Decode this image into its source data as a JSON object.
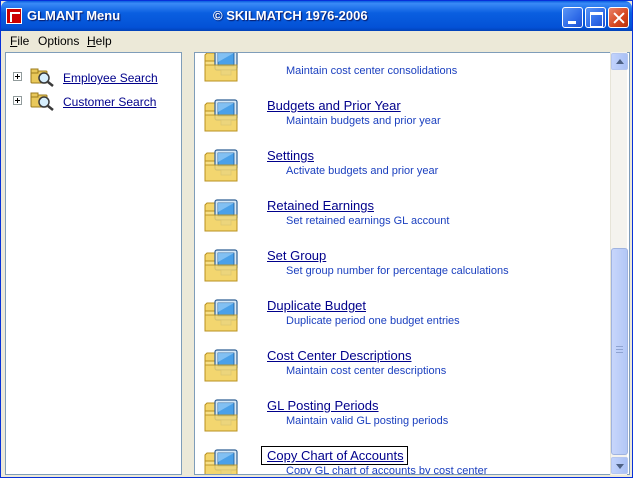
{
  "window": {
    "title": "GLMANT Menu",
    "copyright": "© SKILMATCH 1976-2006"
  },
  "menu": [
    {
      "label_rest": "ile",
      "label_mnemonic": "F",
      "mnemonic_first": true
    },
    {
      "label": "Options"
    },
    {
      "label_rest": "elp",
      "label_mnemonic": "H",
      "mnemonic_first": true
    }
  ],
  "tree": [
    {
      "label": "Employee Search",
      "icon": "search-icon"
    },
    {
      "label": "Customer Search",
      "icon": "search-icon"
    }
  ],
  "items": [
    {
      "title": "",
      "desc": "Maintain cost center consolidations"
    },
    {
      "title": "Budgets and Prior Year",
      "desc": "Maintain budgets and prior year"
    },
    {
      "title": "Settings",
      "desc": "Activate budgets and prior year"
    },
    {
      "title": "Retained Earnings ",
      "desc": "Set retained earnings GL account"
    },
    {
      "title": "Set Group",
      "desc": "Set group number for percentage calculations"
    },
    {
      "title": "Duplicate Budget",
      "desc": "Duplicate period one budget entries"
    },
    {
      "title": "Cost Center Descriptions",
      "desc": "Maintain cost center descriptions"
    },
    {
      "title": "GL Posting Periods",
      "desc": "Maintain valid GL posting periods"
    },
    {
      "title": "Copy Chart of Accounts",
      "desc": "Copy GL chart of accounts by cost center"
    }
  ],
  "colors": {
    "title_bar": "#0a5fe0",
    "link": "#00008b",
    "description": "#1a3fbf",
    "folder": "#f3d56b"
  }
}
